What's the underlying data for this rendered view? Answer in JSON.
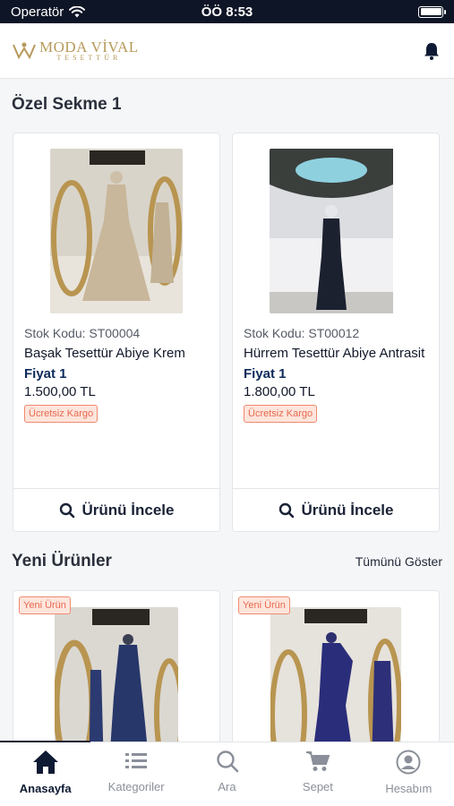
{
  "status_bar": {
    "carrier": "Operatör",
    "time": "ÖÖ 8:53"
  },
  "header": {
    "logo_main": "MODA VİVAL",
    "logo_sub": "TESETTÜR"
  },
  "sections": {
    "special": {
      "title": "Özel Sekme 1",
      "products": [
        {
          "stock": "Stok Kodu: ST00004",
          "name": "Başak Tesettür Abiye Krem",
          "price_label": "Fiyat 1",
          "price": "1.500,00 TL",
          "badge": "Ücretsiz Kargo",
          "button": "Ürünü İncele"
        },
        {
          "stock": "Stok Kodu: ST00012",
          "name": "Hürrem Tesettür Abiye Antrasit",
          "price_label": "Fiyat 1",
          "price": "1.800,00 TL",
          "badge": "Ücretsiz Kargo",
          "button": "Ürünü İncele"
        }
      ]
    },
    "new_products": {
      "title": "Yeni Ürünler",
      "show_all": "Tümünü Göster",
      "badge": "Yeni Ürün"
    }
  },
  "tab_bar": {
    "tabs": [
      {
        "label": "Anasayfa",
        "icon": "home-icon",
        "active": true
      },
      {
        "label": "Kategoriler",
        "icon": "list-icon",
        "active": false
      },
      {
        "label": "Ara",
        "icon": "search-icon",
        "active": false
      },
      {
        "label": "Sepet",
        "icon": "cart-icon",
        "active": false
      },
      {
        "label": "Hesabım",
        "icon": "account-icon",
        "active": false
      }
    ]
  },
  "colors": {
    "primary": "#0e1a33",
    "badge_text": "#e8694f",
    "badge_bg": "#fde5dc",
    "logo_gold": "#b79a5a"
  }
}
